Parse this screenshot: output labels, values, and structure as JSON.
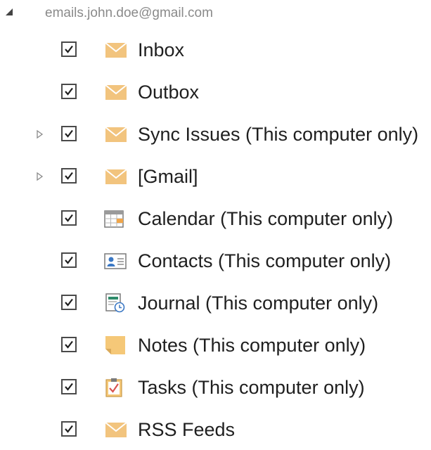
{
  "account": {
    "email": "emails.john.doe@gmail.com",
    "expanded": true
  },
  "folders": [
    {
      "label": "Inbox",
      "checked": true,
      "icon": "mail-icon",
      "has_children": false
    },
    {
      "label": "Outbox",
      "checked": true,
      "icon": "mail-icon",
      "has_children": false
    },
    {
      "label": "Sync Issues (This computer only)",
      "checked": true,
      "icon": "mail-icon",
      "has_children": true
    },
    {
      "label": "[Gmail]",
      "checked": true,
      "icon": "mail-icon",
      "has_children": true
    },
    {
      "label": "Calendar (This computer only)",
      "checked": true,
      "icon": "calendar-icon",
      "has_children": false
    },
    {
      "label": "Contacts (This computer only)",
      "checked": true,
      "icon": "contact-card-icon",
      "has_children": false
    },
    {
      "label": "Journal (This computer only)",
      "checked": true,
      "icon": "journal-icon",
      "has_children": false
    },
    {
      "label": "Notes (This computer only)",
      "checked": true,
      "icon": "note-icon",
      "has_children": false
    },
    {
      "label": "Tasks (This computer only)",
      "checked": true,
      "icon": "task-clipboard-icon",
      "has_children": false
    },
    {
      "label": "RSS Feeds",
      "checked": true,
      "icon": "mail-icon",
      "has_children": false
    }
  ],
  "colors": {
    "mail_icon": "#f2c47e",
    "checkbox_border": "#4a4a4a",
    "account_text": "#8a8a8a",
    "task_check": "#d9534f",
    "contact_blue": "#3b78c4",
    "journal_green": "#2e8b6a"
  }
}
